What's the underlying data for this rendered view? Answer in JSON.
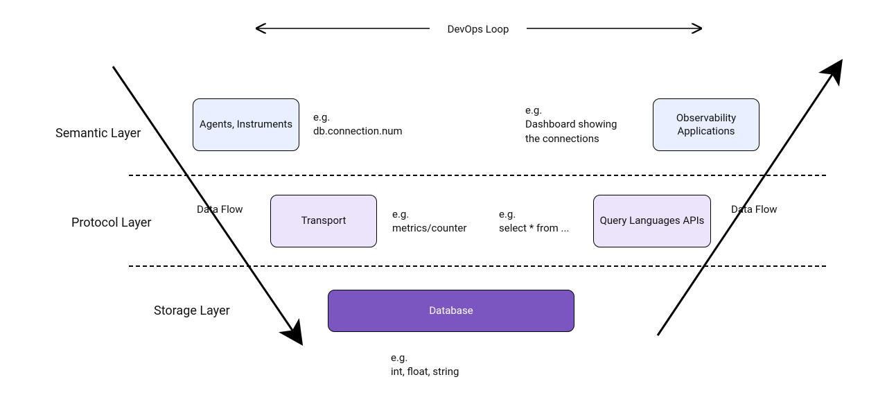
{
  "top": {
    "label": "DevOps Loop"
  },
  "layers": {
    "semantic": {
      "label": "Semantic Layer"
    },
    "protocol": {
      "label": "Protocol Layer"
    },
    "storage": {
      "label": "Storage Layer"
    }
  },
  "boxes": {
    "agents": "Agents,\nInstruments",
    "obs_apps": "Observability\nApplications",
    "transport": "Transport",
    "query": "Query Languages\nAPIs",
    "database": "Database"
  },
  "notes": {
    "semantic_left": "e.g.\ndb.connection.num",
    "semantic_right": "e.g.\nDashboard showing\nthe connections",
    "protocol_left": "e.g.\nmetrics/counter",
    "protocol_right": "e.g.\nselect * from ...",
    "storage": "e.g.\nint, float, string"
  },
  "flow": {
    "left": "Data Flow",
    "right": "Data Flow"
  }
}
